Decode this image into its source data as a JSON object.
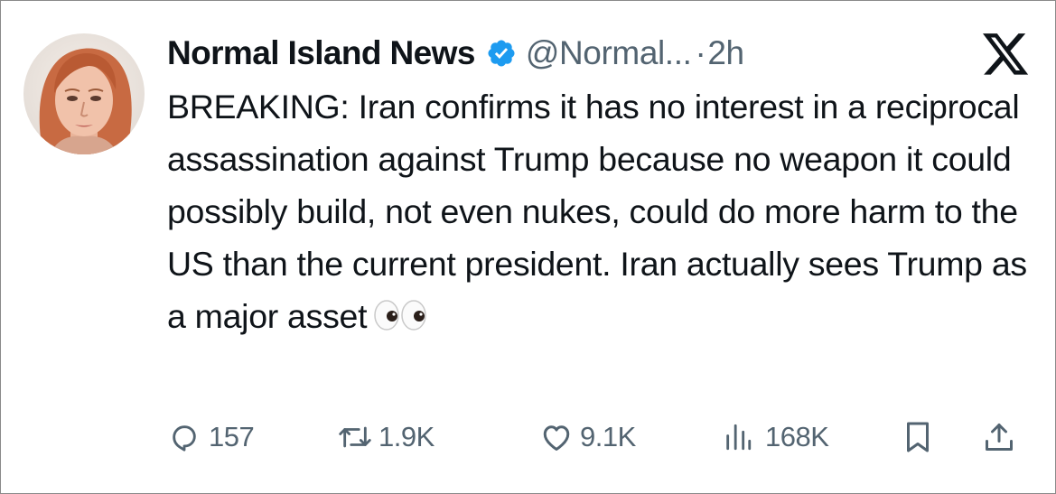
{
  "tweet": {
    "display_name": "Normal Island News",
    "verified": true,
    "handle": "@Normal...",
    "separator": "·",
    "time": "2h",
    "text": "BREAKING: Iran confirms it has no interest in a reciprocal assassination against Trump because no weapon it could possibly build, not even nukes, could do more harm to the US than the current president. Iran actually sees Trump as a major asset",
    "emoji": "eyes-emoji"
  },
  "actions": {
    "replies": "157",
    "reposts": "1.9K",
    "likes": "9.1K",
    "views": "168K"
  },
  "colors": {
    "text": "#0f1419",
    "secondary": "#536471",
    "verified_blue": "#1d9bf0"
  },
  "icons": [
    "verified-badge-icon",
    "x-logo-icon",
    "reply-icon",
    "repost-icon",
    "like-icon",
    "views-icon",
    "bookmark-icon",
    "share-icon"
  ]
}
